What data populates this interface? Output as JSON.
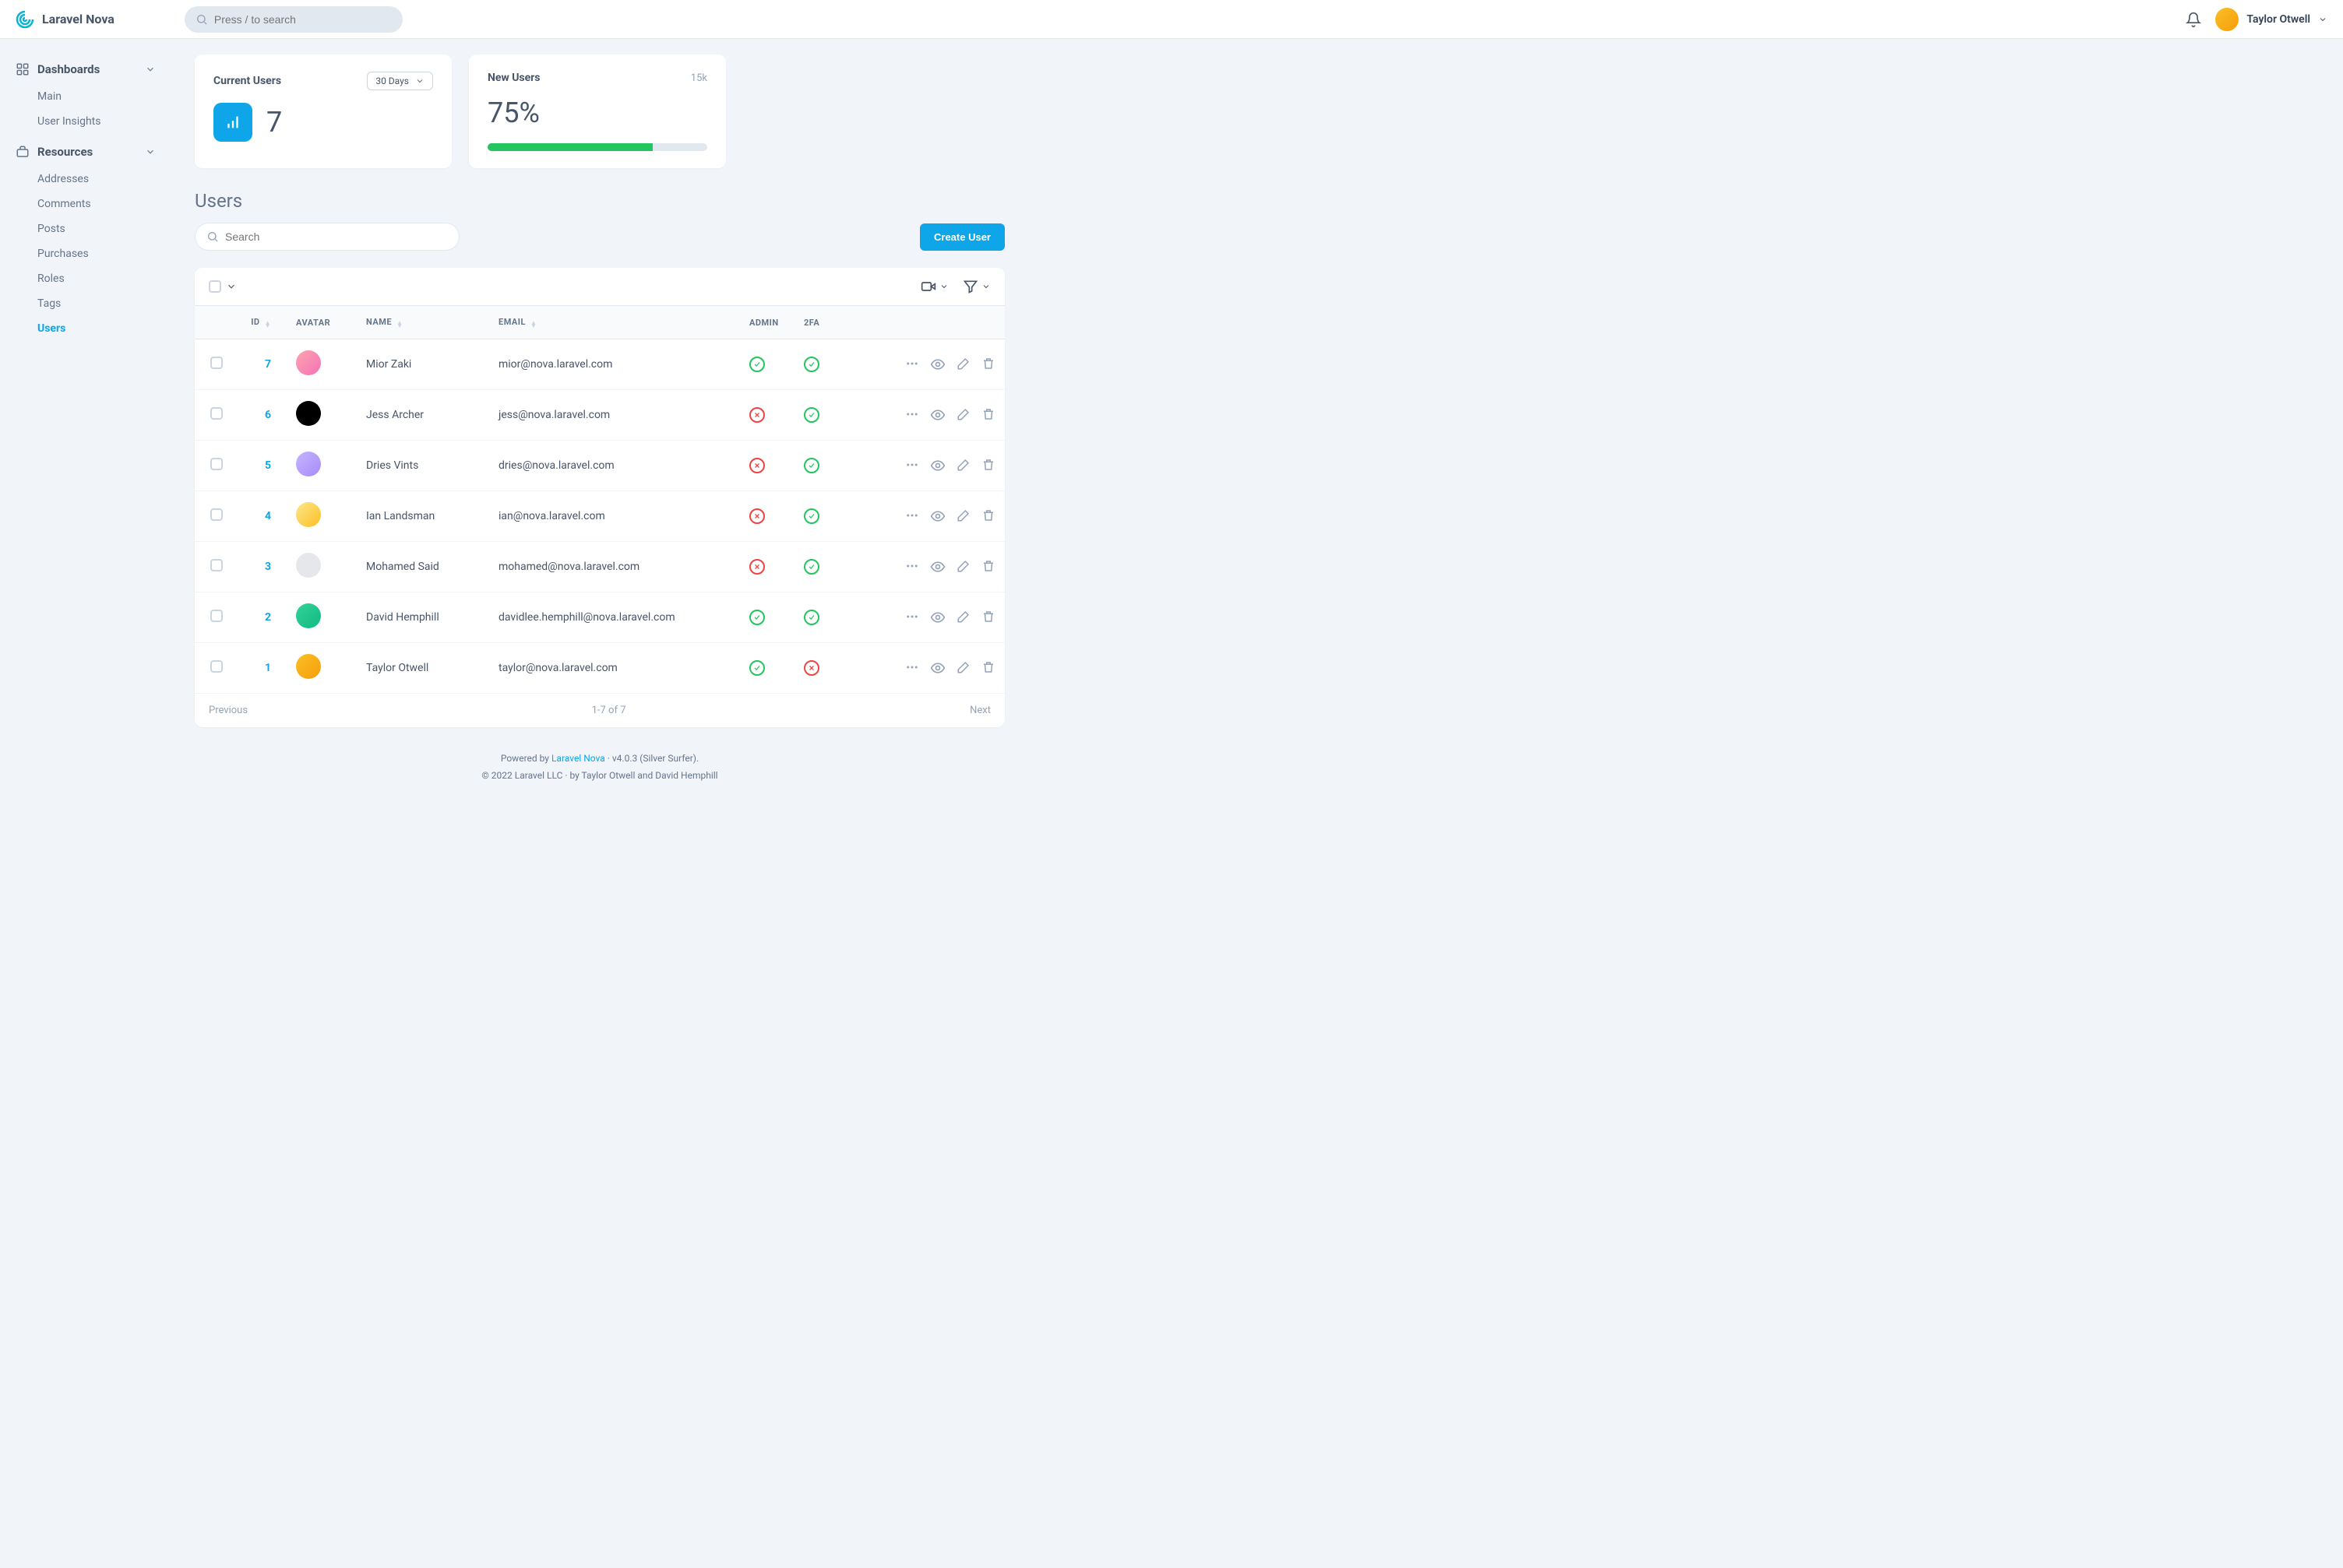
{
  "app_name": "Laravel Nova",
  "search": {
    "placeholder": "Press / to search"
  },
  "user": {
    "name": "Taylor Otwell"
  },
  "sidebar": {
    "dashboards": {
      "label": "Dashboards",
      "items": [
        {
          "label": "Main"
        },
        {
          "label": "User Insights"
        }
      ]
    },
    "resources": {
      "label": "Resources",
      "items": [
        {
          "label": "Addresses"
        },
        {
          "label": "Comments"
        },
        {
          "label": "Posts"
        },
        {
          "label": "Purchases"
        },
        {
          "label": "Roles"
        },
        {
          "label": "Tags"
        },
        {
          "label": "Users",
          "active": true
        }
      ]
    }
  },
  "cards": {
    "current": {
      "title": "Current Users",
      "period": "30 Days",
      "value": "7"
    },
    "new": {
      "title": "New Users",
      "count": "15k",
      "percent": "75%",
      "progress": 75
    }
  },
  "section": {
    "title": "Users",
    "search_placeholder": "Search",
    "create_label": "Create User"
  },
  "table": {
    "columns": {
      "id": "ID",
      "avatar": "AVATAR",
      "name": "NAME",
      "email": "EMAIL",
      "admin": "ADMIN",
      "twofa": "2FA"
    },
    "rows": [
      {
        "id": "7",
        "name": "Mior Zaki",
        "email": "mior@nova.laravel.com",
        "admin": true,
        "twofa": true,
        "avatar_bg": "linear-gradient(135deg,#fda4af,#f472b6)"
      },
      {
        "id": "6",
        "name": "Jess Archer",
        "email": "jess@nova.laravel.com",
        "admin": false,
        "twofa": true,
        "avatar_bg": "#000"
      },
      {
        "id": "5",
        "name": "Dries Vints",
        "email": "dries@nova.laravel.com",
        "admin": false,
        "twofa": true,
        "avatar_bg": "linear-gradient(135deg,#c4b5fd,#a78bfa)"
      },
      {
        "id": "4",
        "name": "Ian Landsman",
        "email": "ian@nova.laravel.com",
        "admin": false,
        "twofa": true,
        "avatar_bg": "linear-gradient(135deg,#fde68a,#fbbf24)"
      },
      {
        "id": "3",
        "name": "Mohamed Said",
        "email": "mohamed@nova.laravel.com",
        "admin": false,
        "twofa": true,
        "avatar_bg": "#e5e7eb"
      },
      {
        "id": "2",
        "name": "David Hemphill",
        "email": "davidlee.hemphill@nova.laravel.com",
        "admin": true,
        "twofa": true,
        "avatar_bg": "linear-gradient(135deg,#34d399,#10b981)"
      },
      {
        "id": "1",
        "name": "Taylor Otwell",
        "email": "taylor@nova.laravel.com",
        "admin": true,
        "twofa": false,
        "avatar_bg": "linear-gradient(135deg,#fbbf24,#f59e0b)"
      }
    ],
    "pagination": {
      "prev": "Previous",
      "info": "1-7 of 7",
      "next": "Next"
    }
  },
  "footer": {
    "line1_pre": "Powered by ",
    "line1_link": "Laravel Nova",
    "line1_post": " · v4.0.3 (Silver Surfer).",
    "line2": "© 2022 Laravel LLC · by Taylor Otwell and David Hemphill"
  }
}
